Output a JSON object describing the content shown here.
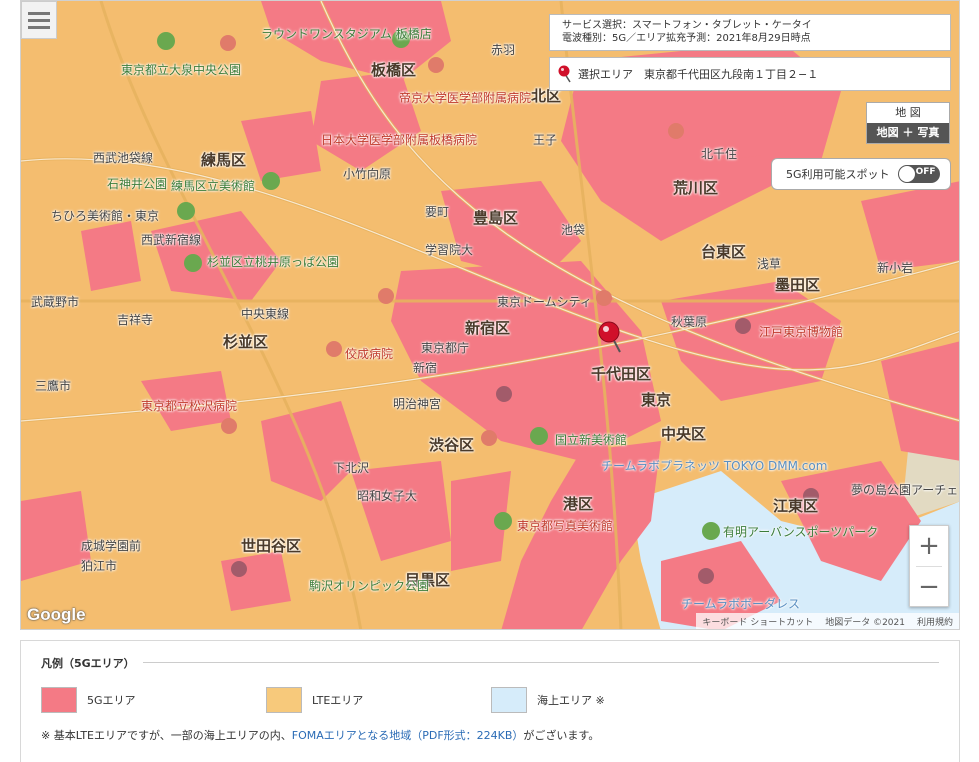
{
  "info": {
    "service": "サービス選択：スマートフォン・タブレット・ケータイ",
    "wave": "電波種別：5G／エリア拡充予測：2021年8月29日時点",
    "selected_area": "選択エリア　東京都千代田区九段南１丁目２−１"
  },
  "map_type": {
    "map": "地 図",
    "map_photo": "地図 ＋ 写真"
  },
  "spot": {
    "label": "5G利用可能スポット",
    "state": "OFF"
  },
  "zoom": {
    "in": "+",
    "out": "−"
  },
  "brand": "Google",
  "attribution": {
    "shortcuts": "キーボード ショートカット",
    "data": "地図データ ©2021",
    "terms": "利用規約"
  },
  "wards": [
    "練馬区",
    "板橋区",
    "北区",
    "豊島区",
    "荒川区",
    "杉並区",
    "新宿区",
    "千代田区",
    "東京",
    "中央区",
    "渋谷区",
    "港区",
    "世田谷区",
    "目黒区",
    "江東区",
    "墨田区",
    "台東区"
  ],
  "places": [
    "東京都立大泉中央公園",
    "ラウンドワンスタジアム 板橋店",
    "赤羽",
    "帝京大学医学部附属病院",
    "日本大学医学部附属板橋病院",
    "石神井公園",
    "練馬区立美術館",
    "小竹向原",
    "要町",
    "池袋",
    "学習院大",
    "東京ドームシティ",
    "秋葉原",
    "江戸東京博物館",
    "浅草",
    "東京都庁",
    "新宿",
    "明治神宮",
    "国立新美術館",
    "チームラボプラネッツ TOKYO DMM.com",
    "有明アーバンスポーツパーク",
    "夢の島公園アーチェリー場",
    "東京都写真美術館",
    "駒沢オリンピック公園",
    "成城学園前",
    "狛江市",
    "三鷹市",
    "武蔵野市",
    "吉祥寺",
    "杉並区立桃井原っぱ公園",
    "佼成病院",
    "東京都立松沢病院",
    "下北沢",
    "昭和女子大",
    "ちひろ美術館・東京",
    "西武池袋線",
    "西武新宿線",
    "中央東線",
    "チームラボボーダレス",
    "王子",
    "北千住",
    "新小岩"
  ],
  "legend": {
    "title": "凡例（5Gエリア）",
    "items": [
      {
        "label": "5Gエリア",
        "color": "#f47a85"
      },
      {
        "label": "LTEエリア",
        "color": "#f7c97b"
      },
      {
        "label": "海上エリア ※",
        "color": "#d6ecfa"
      }
    ],
    "note_prefix": "※ 基本LTEエリアですが、一部の海上エリアの内、",
    "note_link": "FOMAエリアとなる地域（PDF形式：224KB）",
    "note_suffix": "がございます。"
  },
  "colors": {
    "five_g": "#f47a85",
    "lte": "#f4bd6f",
    "sea": "#d6ecfa",
    "pin": "#d0102a"
  }
}
